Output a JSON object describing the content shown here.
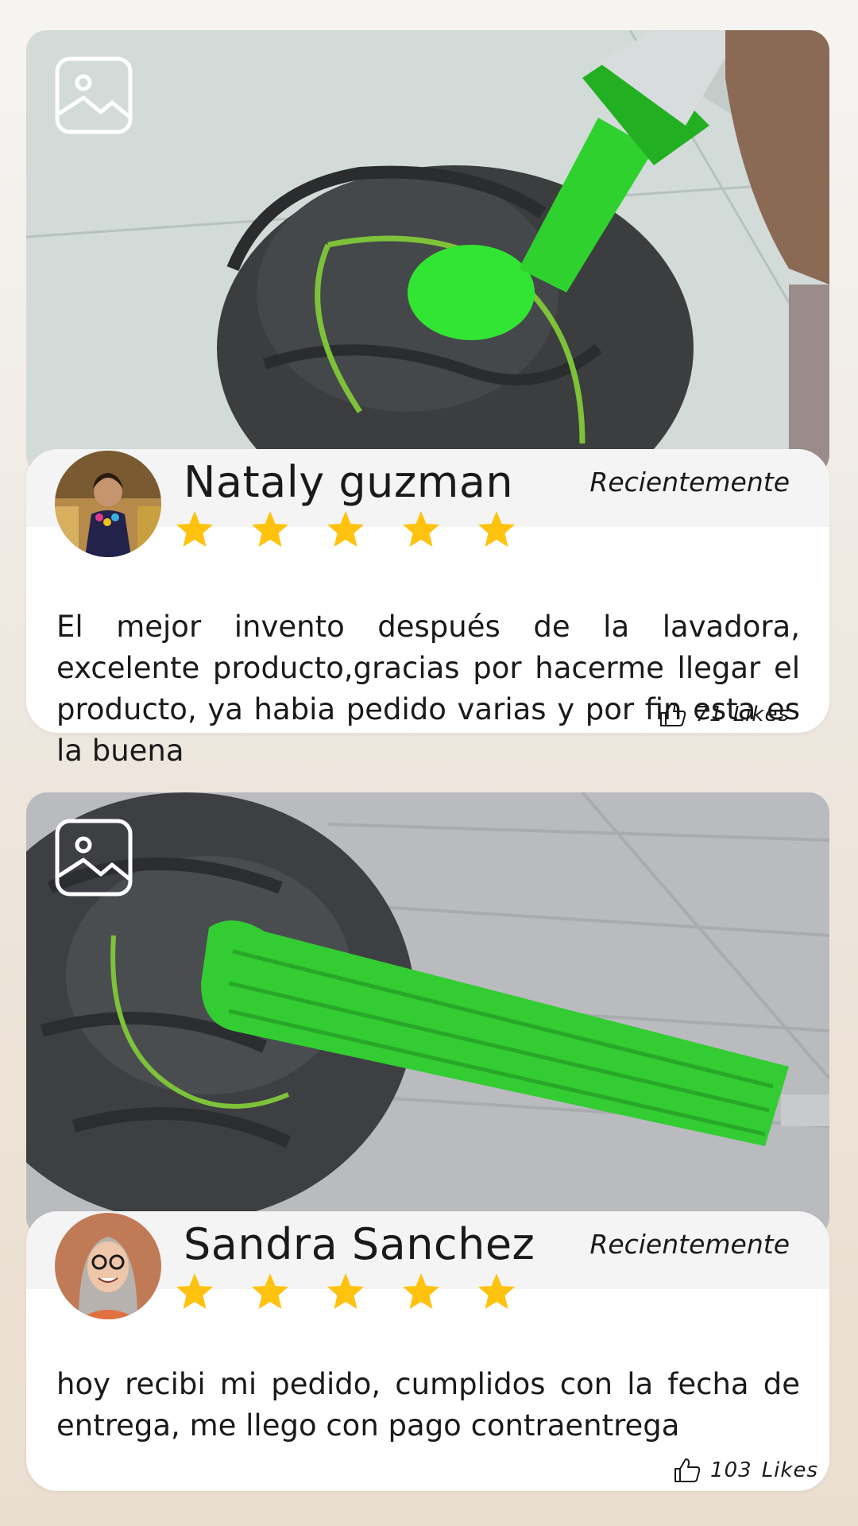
{
  "reviews": [
    {
      "name": "Nataly guzman",
      "date": "Recientemente",
      "rating": 5,
      "text": "El mejor invento después de la lavadora, excelente producto,gracias por hacerme llegar el producto, ya habia pedido varias y por fin esta es la buena",
      "likes_count": "71",
      "likes_label": "Likes"
    },
    {
      "name": "Sandra Sanchez",
      "date": "Recientemente",
      "rating": 5,
      "text": "hoy recibi mi pedido, cumplidos con la fecha de entrega, me llego con pago contraentrega",
      "likes_count": "103",
      "likes_label": "Likes"
    }
  ],
  "icons": {
    "gallery": "image-icon",
    "star": "star-icon",
    "like": "thumbs-up-icon"
  },
  "colors": {
    "star": "#ffc20e",
    "mop_green": "#2fcf2f",
    "mop_yarn": "#3a3c3e"
  }
}
